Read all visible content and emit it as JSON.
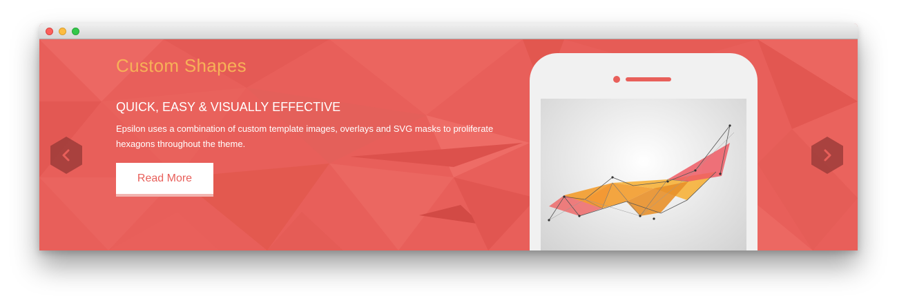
{
  "window": {
    "buttons": [
      "close",
      "minimize",
      "maximize"
    ]
  },
  "slide": {
    "title": "Custom Shapes",
    "subtitle": "QUICK, EASY & VISUALLY EFFECTIVE",
    "body": "Epsilon uses a combination of custom template images, overlays and SVG masks to proliferate hexagons throughout the theme.",
    "button_label": "Read More"
  },
  "nav": {
    "prev_icon": "chevron-left-icon",
    "next_icon": "chevron-right-icon"
  },
  "colors": {
    "background": "#e85f5a",
    "title": "#f7b158",
    "nav_hexagon": "#9e3c3a",
    "phone": "#f1f1f1"
  }
}
